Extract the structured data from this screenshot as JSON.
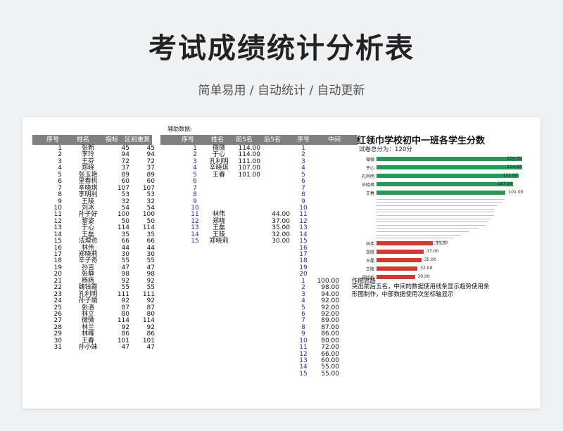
{
  "page": {
    "title": "考试成绩统计分析表",
    "subtitle": "简单易用 / 自动统计 / 自动更新"
  },
  "main_table": {
    "headers": [
      "序号",
      "姓名",
      "指标",
      "区别重复"
    ],
    "rows": [
      {
        "no": "1",
        "name": "张新",
        "score": "45",
        "dedup": "45"
      },
      {
        "no": "2",
        "name": "李玲",
        "score": "94",
        "dedup": "94"
      },
      {
        "no": "3",
        "name": "王芬",
        "score": "72",
        "dedup": "72"
      },
      {
        "no": "4",
        "name": "郑晓",
        "score": "37",
        "dedup": "37"
      },
      {
        "no": "5",
        "name": "张玉艳",
        "score": "89",
        "dedup": "89"
      },
      {
        "no": "6",
        "name": "里春桃",
        "score": "60",
        "dedup": "60"
      },
      {
        "no": "7",
        "name": "辛晓琪",
        "score": "107",
        "dedup": "107"
      },
      {
        "no": "8",
        "name": "李明利",
        "score": "53",
        "dedup": "53"
      },
      {
        "no": "9",
        "name": "王陵",
        "score": "32",
        "dedup": "32"
      },
      {
        "no": "10",
        "name": "刘冰",
        "score": "54",
        "dedup": "54"
      },
      {
        "no": "11",
        "name": "孙子好",
        "score": "100",
        "dedup": "100"
      },
      {
        "no": "12",
        "name": "黎姿",
        "score": "50",
        "dedup": "50"
      },
      {
        "no": "13",
        "name": "于心",
        "score": "114",
        "dedup": "114"
      },
      {
        "no": "14",
        "name": "王磊",
        "score": "35",
        "dedup": "35"
      },
      {
        "no": "15",
        "name": "法理资",
        "score": "66",
        "dedup": "66"
      },
      {
        "no": "16",
        "name": "林伟",
        "score": "44",
        "dedup": "44"
      },
      {
        "no": "17",
        "name": "郑晓莉",
        "score": "30",
        "dedup": "30"
      },
      {
        "no": "18",
        "name": "辛子奇",
        "score": "55",
        "dedup": "55"
      },
      {
        "no": "19",
        "name": "孙吉",
        "score": "47",
        "dedup": "47"
      },
      {
        "no": "20",
        "name": "张静",
        "score": "98",
        "dedup": "98"
      },
      {
        "no": "21",
        "name": "杨杨",
        "score": "92",
        "dedup": "92"
      },
      {
        "no": "22",
        "name": "魏钱霞",
        "score": "55",
        "dedup": "55"
      },
      {
        "no": "23",
        "name": "孔利明",
        "score": "111",
        "dedup": "111"
      },
      {
        "no": "24",
        "name": "孙子瑜",
        "score": "92",
        "dedup": "92"
      },
      {
        "no": "25",
        "name": "张清",
        "score": "87",
        "dedup": "87"
      },
      {
        "no": "26",
        "name": "林立",
        "score": "80",
        "dedup": "80"
      },
      {
        "no": "27",
        "name": "微微",
        "score": "114",
        "dedup": "114"
      },
      {
        "no": "28",
        "name": "林兰",
        "score": "92",
        "dedup": "92"
      },
      {
        "no": "29",
        "name": "林峰",
        "score": "86",
        "dedup": "86"
      },
      {
        "no": "30",
        "name": "王春",
        "score": "101",
        "dedup": "101"
      },
      {
        "no": "31",
        "name": "孙小妹",
        "score": "47",
        "dedup": "47"
      }
    ]
  },
  "aux": {
    "label": "辅助数据:",
    "headers": [
      "序号",
      "姓名",
      "前5名",
      "后5名",
      "序号",
      "中间"
    ],
    "rows": [
      {
        "no": "1",
        "name": "微微",
        "top5": "114.00",
        "bottom5": ""
      },
      {
        "no": "2",
        "name": "于心",
        "top5": "114.00",
        "bottom5": ""
      },
      {
        "no": "3",
        "name": "孔利明",
        "top5": "111.00",
        "bottom5": ""
      },
      {
        "no": "4",
        "name": "辛晓琪",
        "top5": "107.00",
        "bottom5": ""
      },
      {
        "no": "5",
        "name": "王春",
        "top5": "101.00",
        "bottom5": ""
      },
      {
        "no": "6",
        "name": "",
        "top5": "",
        "bottom5": ""
      },
      {
        "no": "7",
        "name": "",
        "top5": "",
        "bottom5": ""
      },
      {
        "no": "8",
        "name": "",
        "top5": "",
        "bottom5": ""
      },
      {
        "no": "9",
        "name": "",
        "top5": "",
        "bottom5": ""
      },
      {
        "no": "10",
        "name": "",
        "top5": "",
        "bottom5": ""
      },
      {
        "no": "11",
        "name": "林伟",
        "top5": "",
        "bottom5": "44.00"
      },
      {
        "no": "12",
        "name": "郑晓",
        "top5": "",
        "bottom5": "37.00"
      },
      {
        "no": "13",
        "name": "王磊",
        "top5": "",
        "bottom5": "35.00"
      },
      {
        "no": "14",
        "name": "王陵",
        "top5": "",
        "bottom5": "32.00"
      },
      {
        "no": "15",
        "name": "郑晓莉",
        "top5": "",
        "bottom5": "30.00"
      }
    ],
    "mid_rows": [
      {
        "no": "1",
        "val": ""
      },
      {
        "no": "2",
        "val": ""
      },
      {
        "no": "3",
        "val": ""
      },
      {
        "no": "4",
        "val": ""
      },
      {
        "no": "5",
        "val": ""
      },
      {
        "no": "6",
        "val": ""
      },
      {
        "no": "7",
        "val": ""
      },
      {
        "no": "8",
        "val": ""
      },
      {
        "no": "9",
        "val": ""
      },
      {
        "no": "10",
        "val": ""
      },
      {
        "no": "11",
        "val": ""
      },
      {
        "no": "12",
        "val": ""
      },
      {
        "no": "13",
        "val": ""
      },
      {
        "no": "14",
        "val": ""
      },
      {
        "no": "15",
        "val": ""
      },
      {
        "no": "16",
        "val": ""
      },
      {
        "no": "17",
        "val": ""
      },
      {
        "no": "18",
        "val": ""
      },
      {
        "no": "19",
        "val": ""
      },
      {
        "no": "20",
        "val": ""
      },
      {
        "no": "1",
        "val": "100.00"
      },
      {
        "no": "2",
        "val": "98.00"
      },
      {
        "no": "3",
        "val": "94.00"
      },
      {
        "no": "4",
        "val": "92.00"
      },
      {
        "no": "5",
        "val": "92.00"
      },
      {
        "no": "6",
        "val": "92.00"
      },
      {
        "no": "7",
        "val": "89.00"
      },
      {
        "no": "8",
        "val": "87.00"
      },
      {
        "no": "9",
        "val": "86.00"
      },
      {
        "no": "10",
        "val": "80.00"
      },
      {
        "no": "11",
        "val": "72.00"
      },
      {
        "no": "12",
        "val": "66.00"
      },
      {
        "no": "13",
        "val": "60.00"
      },
      {
        "no": "14",
        "val": "55.00"
      },
      {
        "no": "15",
        "val": "55.00"
      }
    ]
  },
  "chart": {
    "title": "红领巾学校初中一班各学生分数",
    "total_label": "试卷总分为：120分",
    "note_title": "作图思路",
    "note_body": "突出前后五名，中间的数据使用线条显示趋势使用条形图制作，中部数据使用次坐标轴显示",
    "colors": {
      "top": "#239a55",
      "bottom": "#d13a2f",
      "middle": "#bdbdbd"
    }
  },
  "chart_data": {
    "type": "bar",
    "orientation": "horizontal",
    "title": "红领巾学校初中一班各学生分数",
    "max": 120,
    "top5": [
      {
        "name": "微微",
        "value": 114.0,
        "label": "114.00"
      },
      {
        "name": "于心",
        "value": 114.0,
        "label": "114.00"
      },
      {
        "name": "孔利明",
        "value": 111.0,
        "label": "111.00"
      },
      {
        "name": "辛晓琪",
        "value": 107.0,
        "label": "107.00"
      },
      {
        "name": "王春",
        "value": 101.0,
        "label": "101.00"
      }
    ],
    "middle": [
      100,
      98,
      94,
      92,
      92,
      92,
      89,
      87,
      86,
      80,
      72,
      66,
      60,
      55,
      55
    ],
    "bottom5": [
      {
        "name": "林伟",
        "value": 44.0,
        "label": "44.00"
      },
      {
        "name": "郑晓",
        "value": 37.0,
        "label": "37.00"
      },
      {
        "name": "王磊",
        "value": 35.0,
        "label": "35.00"
      },
      {
        "name": "王陵",
        "value": 32.0,
        "label": "32.00"
      },
      {
        "name": "郑晓莉",
        "value": 30.0,
        "label": "30.00"
      }
    ]
  }
}
